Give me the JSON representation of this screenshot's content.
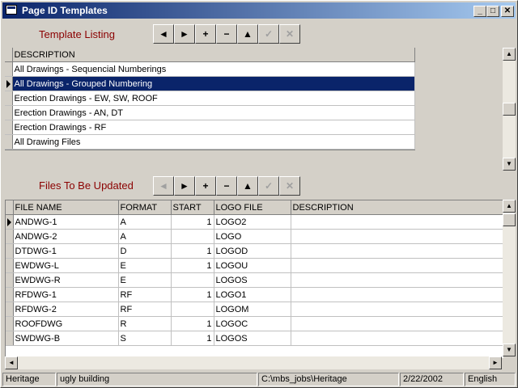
{
  "window": {
    "title": "Page ID Templates",
    "min_label": "_",
    "max_label": "□",
    "close_label": "✕"
  },
  "templates": {
    "label": "Template Listing",
    "nav": [
      "◄",
      "►",
      "+",
      "−",
      "▲",
      "✓",
      "✕"
    ],
    "header": "DESCRIPTION",
    "rows": [
      "All Drawings - Sequencial Numberings",
      "All Drawings - Grouped Numbering",
      "Erection Drawings  -  EW, SW, ROOF",
      "Erection Drawings - AN, DT",
      "Erection Drawings - RF",
      "All Drawing Files"
    ],
    "selected_index": 1
  },
  "files": {
    "label": "Files To Be Updated",
    "nav": [
      "◄",
      "►",
      "+",
      "−",
      "▲",
      "✓",
      "✕"
    ],
    "headers": [
      "FILE NAME",
      "FORMAT",
      "START",
      "LOGO FILE",
      "DESCRIPTION"
    ],
    "rows": [
      [
        "ANDWG-1",
        "A",
        "1",
        "LOGO2",
        ""
      ],
      [
        "ANDWG-2",
        "A",
        "",
        "LOGO",
        ""
      ],
      [
        "DTDWG-1",
        "D",
        "1",
        "LOGOD",
        ""
      ],
      [
        "EWDWG-L",
        "E",
        "1",
        "LOGOU",
        ""
      ],
      [
        "EWDWG-R",
        "E",
        "",
        "LOGOS",
        ""
      ],
      [
        "RFDWG-1",
        "RF",
        "1",
        "LOGO1",
        ""
      ],
      [
        "RFDWG-2",
        "RF",
        "",
        "LOGOM",
        ""
      ],
      [
        "ROOFDWG",
        "R",
        "1",
        "LOGOC",
        ""
      ],
      [
        "SWDWG-B",
        "S",
        "1",
        "LOGOS",
        ""
      ]
    ]
  },
  "statusbar": {
    "project": "Heritage",
    "description": "ugly building",
    "path": "C:\\mbs_jobs\\Heritage",
    "date": "2/22/2002",
    "units": "English"
  },
  "icons": {
    "scroll_up": "up-arrow-icon",
    "scroll_down": "down-arrow-icon",
    "scroll_left": "left-arrow-icon",
    "scroll_right": "right-arrow-icon"
  }
}
